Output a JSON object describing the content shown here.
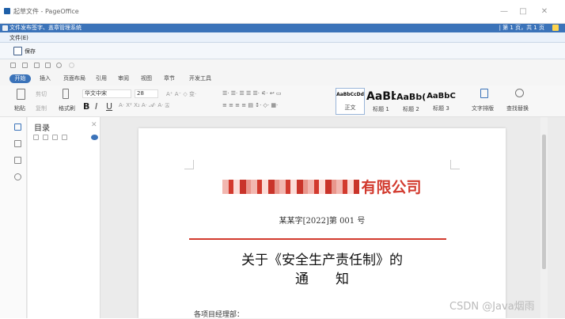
{
  "window": {
    "title": "起草文件 - PageOffice",
    "min": "—",
    "max": "□",
    "close": "✕"
  },
  "header": {
    "title": "文件发布签字、盖章管理系统",
    "page_info": "| 第 1 页，共 1 页"
  },
  "menu": {
    "file": "文件(E)"
  },
  "toolbar": {
    "save_label": "保存"
  },
  "tabs": [
    "开始",
    "插入",
    "页面布局",
    "引用",
    "审阅",
    "视图",
    "章节",
    "开发工具"
  ],
  "ribbon": {
    "paste": "粘贴",
    "cut": "剪切",
    "copy": "复制",
    "format_painter": "格式刷",
    "font_name": "华文中宋",
    "font_size": "28",
    "bold": "B",
    "italic": "I",
    "underline": "U",
    "styles": [
      {
        "sample": "AaBbCcDd",
        "label": "正文"
      },
      {
        "sample": "AaBb",
        "label": "标题 1"
      },
      {
        "sample": "AaBb(",
        "label": "标题 2"
      },
      {
        "sample": "AaBbC",
        "label": "标题 3"
      }
    ],
    "text_layout": "文字排版",
    "find_replace": "查找替换"
  },
  "outline": {
    "title": "目录",
    "close": "✕"
  },
  "document": {
    "company_suffix": "有限公司",
    "doc_number": "某某字[2022]第 001 号",
    "heading_line1": "关于《安全生产责任制》的",
    "heading_line2": "通　　知",
    "addressee": "各项目经理部："
  },
  "watermark": "CSDN @Java烟雨",
  "colors": {
    "accent": "#3b73b9",
    "red": "#d23a2e"
  }
}
